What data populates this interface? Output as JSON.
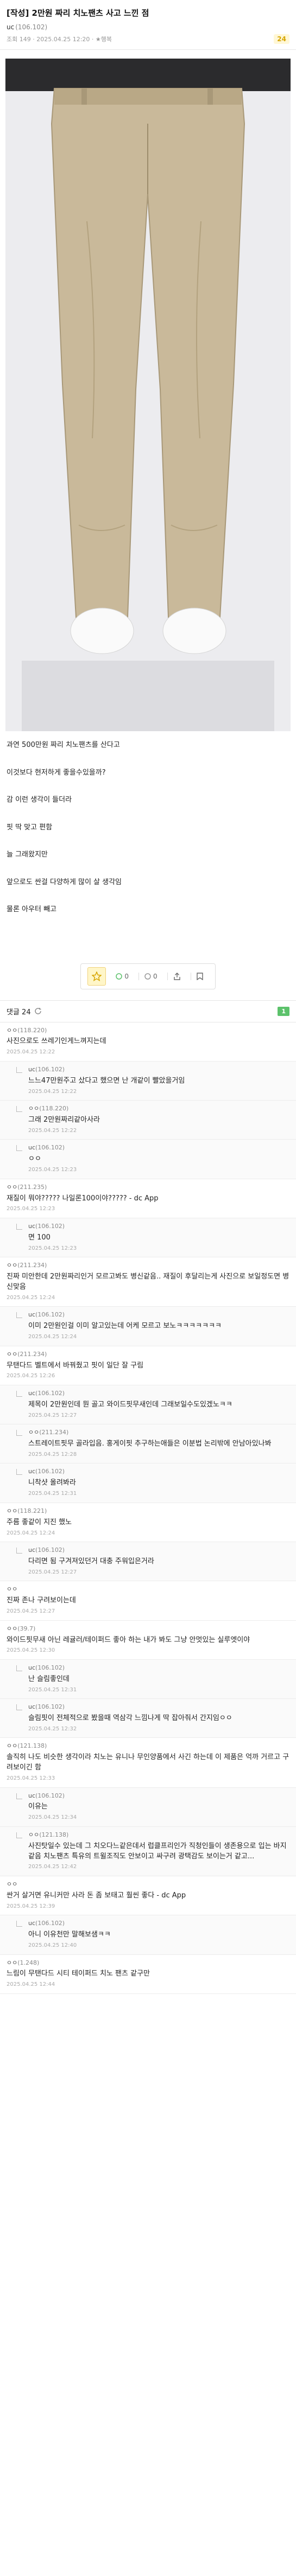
{
  "post": {
    "title": "[작성] 2만원 짜리 치노팬츠 사고 느낀 점",
    "author": "uc",
    "ip": "(106.102)",
    "meta": "조회 149 · 2025.04.25 12:20 · ★행복",
    "reply_count": "24"
  },
  "body": [
    "과연 500만원 짜리 치노팬츠를 산다고",
    "이것보다 현저하게 좋을수있을까?",
    "감 이런 생각이 들더라",
    "핏 딱 맞고 편함",
    "늘 그래왔지만",
    "앞으로도 싼걸 다양하게 많이 살 생각임",
    "물론 아우터 빼고"
  ],
  "votes": {
    "up": "0",
    "down": "0"
  },
  "comments_header": {
    "label": "댓글 24",
    "page": "1"
  },
  "comments": [
    {
      "reply": false,
      "author": "ㅇㅇ",
      "ip": "(118.220)",
      "text": "사진으로도 쓰레기인게느껴지는데",
      "date": "2025.04.25 12:22"
    },
    {
      "reply": true,
      "author": "uc",
      "ip": "(106.102)",
      "text": "느느47만원주고 샀다고 했으면 난 개같이 빨았을거임",
      "date": "2025.04.25 12:22"
    },
    {
      "reply": true,
      "author": "ㅇㅇ",
      "ip": "(118.220)",
      "text": "그래 2만원짜리같아사라",
      "date": "2025.04.25 12:22"
    },
    {
      "reply": true,
      "author": "uc",
      "ip": "(106.102)",
      "text": "ㅇㅇ",
      "date": "2025.04.25 12:23"
    },
    {
      "reply": false,
      "author": "ㅇㅇ",
      "ip": "(211.235)",
      "text": "재질이 뭐야????? 나일론100이야????? - dc App",
      "date": "2025.04.25 12:23"
    },
    {
      "reply": true,
      "author": "uc",
      "ip": "(106.102)",
      "text": "면 100",
      "date": "2025.04.25 12:23"
    },
    {
      "reply": false,
      "author": "ㅇㅇ",
      "ip": "(211.234)",
      "text": "진짜 미안한데 2만원짜리인거 모르고봐도 병신같음.. 재질이 후달리는게 사진으로 보일정도면 병신맞음",
      "date": "2025.04.25 12:24"
    },
    {
      "reply": true,
      "author": "uc",
      "ip": "(106.102)",
      "text": "이미 2만원인걸 이미 알고있는데 어케 모르고 보노ㅋㅋㅋㅋㅋㅋㅋ",
      "date": "2025.04.25 12:24"
    },
    {
      "reply": false,
      "author": "ㅇㅇ",
      "ip": "(211.234)",
      "text": "무탠다드 벨트에서 바꿔줬고 핏이 일단 잘 구림",
      "date": "2025.04.25 12:26"
    },
    {
      "reply": true,
      "author": "uc",
      "ip": "(106.102)",
      "text": "제목이 2만원인데 뭔 골고 와이드핏무새인데 그래보일수도있겠노ㅋㅋ",
      "date": "2025.04.25 12:27"
    },
    {
      "reply": true,
      "author": "ㅇㅇ",
      "ip": "(211.234)",
      "text": "스트레이트핏무 골라입음. 홍게이핏 추구하는애들은 이분법 논리밖에 안남아있나봐",
      "date": "2025.04.25 12:28"
    },
    {
      "reply": true,
      "author": "uc",
      "ip": "(106.102)",
      "text": "니착샷 올려봐라",
      "date": "2025.04.25 12:31"
    },
    {
      "reply": false,
      "author": "ㅇㅇ",
      "ip": "(118.221)",
      "text": "주름 좋같이 지진 했노",
      "date": "2025.04.25 12:24"
    },
    {
      "reply": true,
      "author": "uc",
      "ip": "(106.102)",
      "text": "다리면 됨 구겨져있던거 대충 주워입은거라",
      "date": "2025.04.25 12:27"
    },
    {
      "reply": false,
      "author": "ㅇㅇ",
      "ip": "",
      "text": "진짜 존나 구려보이는데",
      "date": "2025.04.25 12:27"
    },
    {
      "reply": false,
      "author": "ㅇㅇ",
      "ip": "(39.7)",
      "text": "와이드핏무새 아닌 레귤러/테이퍼드 좋아 하는 내가 봐도 그냥 안멋있는 실루엣이야",
      "date": "2025.04.25 12:30"
    },
    {
      "reply": true,
      "author": "uc",
      "ip": "(106.102)",
      "text": "난 슬림좋인데",
      "date": "2025.04.25 12:31"
    },
    {
      "reply": true,
      "author": "uc",
      "ip": "(106.102)",
      "text": "슬림핏이 전체적으로 봤을때 역삼각 느낌나게 딱 잡아줘서 간지임ㅇㅇ",
      "date": "2025.04.25 12:32"
    },
    {
      "reply": false,
      "author": "ㅇㅇ",
      "ip": "(121.138)",
      "text": "솔직히 나도 비슷한 생각이라 치노는 유니나 무인양품에서 사긴 하는데 이 제품은 억까 거르고 구려보이긴 함",
      "date": "2025.04.25 12:33"
    },
    {
      "reply": true,
      "author": "uc",
      "ip": "(106.102)",
      "text": "이유는",
      "date": "2025.04.25 12:34"
    },
    {
      "reply": true,
      "author": "ㅇㅇ",
      "ip": "(121.138)",
      "text": "사진탓일수 있는데 그 치오다느같은데서 럽클프리인가 직청인들이 생존용으로 입는 바지같음 치노팬츠 특유의 트윌조직도 안보이고 싸구려 광택감도 보이는거 같고...",
      "date": "2025.04.25 12:42"
    },
    {
      "reply": false,
      "author": "ㅇㅇ",
      "ip": "",
      "text": "싼거 살거면 유니커만 사라 돈 좀 보태고 훨씬 좋다 - dc App",
      "date": "2025.04.25 12:39"
    },
    {
      "reply": true,
      "author": "uc",
      "ip": "(106.102)",
      "text": "아니 이유천만 말해보샘ㅋㅋ",
      "date": "2025.04.25 12:40"
    },
    {
      "reply": false,
      "author": "ㅇㅇ",
      "ip": "(1.248)",
      "text": "느림이 무탠다드 시티 테이퍼드 치노 팬츠 같구만",
      "date": "2025.04.25 12:44"
    }
  ]
}
